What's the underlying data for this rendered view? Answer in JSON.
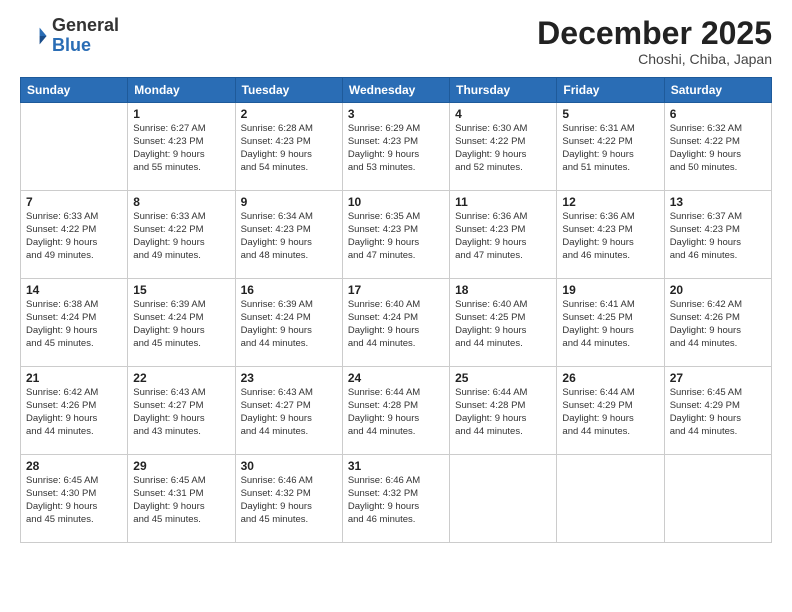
{
  "header": {
    "logo_general": "General",
    "logo_blue": "Blue",
    "month_title": "December 2025",
    "location": "Choshi, Chiba, Japan"
  },
  "weekdays": [
    "Sunday",
    "Monday",
    "Tuesday",
    "Wednesday",
    "Thursday",
    "Friday",
    "Saturday"
  ],
  "weeks": [
    [
      {
        "day": "",
        "info": ""
      },
      {
        "day": "1",
        "info": "Sunrise: 6:27 AM\nSunset: 4:23 PM\nDaylight: 9 hours\nand 55 minutes."
      },
      {
        "day": "2",
        "info": "Sunrise: 6:28 AM\nSunset: 4:23 PM\nDaylight: 9 hours\nand 54 minutes."
      },
      {
        "day": "3",
        "info": "Sunrise: 6:29 AM\nSunset: 4:23 PM\nDaylight: 9 hours\nand 53 minutes."
      },
      {
        "day": "4",
        "info": "Sunrise: 6:30 AM\nSunset: 4:22 PM\nDaylight: 9 hours\nand 52 minutes."
      },
      {
        "day": "5",
        "info": "Sunrise: 6:31 AM\nSunset: 4:22 PM\nDaylight: 9 hours\nand 51 minutes."
      },
      {
        "day": "6",
        "info": "Sunrise: 6:32 AM\nSunset: 4:22 PM\nDaylight: 9 hours\nand 50 minutes."
      }
    ],
    [
      {
        "day": "7",
        "info": "Sunrise: 6:33 AM\nSunset: 4:22 PM\nDaylight: 9 hours\nand 49 minutes."
      },
      {
        "day": "8",
        "info": "Sunrise: 6:33 AM\nSunset: 4:22 PM\nDaylight: 9 hours\nand 49 minutes."
      },
      {
        "day": "9",
        "info": "Sunrise: 6:34 AM\nSunset: 4:23 PM\nDaylight: 9 hours\nand 48 minutes."
      },
      {
        "day": "10",
        "info": "Sunrise: 6:35 AM\nSunset: 4:23 PM\nDaylight: 9 hours\nand 47 minutes."
      },
      {
        "day": "11",
        "info": "Sunrise: 6:36 AM\nSunset: 4:23 PM\nDaylight: 9 hours\nand 47 minutes."
      },
      {
        "day": "12",
        "info": "Sunrise: 6:36 AM\nSunset: 4:23 PM\nDaylight: 9 hours\nand 46 minutes."
      },
      {
        "day": "13",
        "info": "Sunrise: 6:37 AM\nSunset: 4:23 PM\nDaylight: 9 hours\nand 46 minutes."
      }
    ],
    [
      {
        "day": "14",
        "info": "Sunrise: 6:38 AM\nSunset: 4:24 PM\nDaylight: 9 hours\nand 45 minutes."
      },
      {
        "day": "15",
        "info": "Sunrise: 6:39 AM\nSunset: 4:24 PM\nDaylight: 9 hours\nand 45 minutes."
      },
      {
        "day": "16",
        "info": "Sunrise: 6:39 AM\nSunset: 4:24 PM\nDaylight: 9 hours\nand 44 minutes."
      },
      {
        "day": "17",
        "info": "Sunrise: 6:40 AM\nSunset: 4:24 PM\nDaylight: 9 hours\nand 44 minutes."
      },
      {
        "day": "18",
        "info": "Sunrise: 6:40 AM\nSunset: 4:25 PM\nDaylight: 9 hours\nand 44 minutes."
      },
      {
        "day": "19",
        "info": "Sunrise: 6:41 AM\nSunset: 4:25 PM\nDaylight: 9 hours\nand 44 minutes."
      },
      {
        "day": "20",
        "info": "Sunrise: 6:42 AM\nSunset: 4:26 PM\nDaylight: 9 hours\nand 44 minutes."
      }
    ],
    [
      {
        "day": "21",
        "info": "Sunrise: 6:42 AM\nSunset: 4:26 PM\nDaylight: 9 hours\nand 44 minutes."
      },
      {
        "day": "22",
        "info": "Sunrise: 6:43 AM\nSunset: 4:27 PM\nDaylight: 9 hours\nand 43 minutes."
      },
      {
        "day": "23",
        "info": "Sunrise: 6:43 AM\nSunset: 4:27 PM\nDaylight: 9 hours\nand 44 minutes."
      },
      {
        "day": "24",
        "info": "Sunrise: 6:44 AM\nSunset: 4:28 PM\nDaylight: 9 hours\nand 44 minutes."
      },
      {
        "day": "25",
        "info": "Sunrise: 6:44 AM\nSunset: 4:28 PM\nDaylight: 9 hours\nand 44 minutes."
      },
      {
        "day": "26",
        "info": "Sunrise: 6:44 AM\nSunset: 4:29 PM\nDaylight: 9 hours\nand 44 minutes."
      },
      {
        "day": "27",
        "info": "Sunrise: 6:45 AM\nSunset: 4:29 PM\nDaylight: 9 hours\nand 44 minutes."
      }
    ],
    [
      {
        "day": "28",
        "info": "Sunrise: 6:45 AM\nSunset: 4:30 PM\nDaylight: 9 hours\nand 45 minutes."
      },
      {
        "day": "29",
        "info": "Sunrise: 6:45 AM\nSunset: 4:31 PM\nDaylight: 9 hours\nand 45 minutes."
      },
      {
        "day": "30",
        "info": "Sunrise: 6:46 AM\nSunset: 4:32 PM\nDaylight: 9 hours\nand 45 minutes."
      },
      {
        "day": "31",
        "info": "Sunrise: 6:46 AM\nSunset: 4:32 PM\nDaylight: 9 hours\nand 46 minutes."
      },
      {
        "day": "",
        "info": ""
      },
      {
        "day": "",
        "info": ""
      },
      {
        "day": "",
        "info": ""
      }
    ]
  ]
}
